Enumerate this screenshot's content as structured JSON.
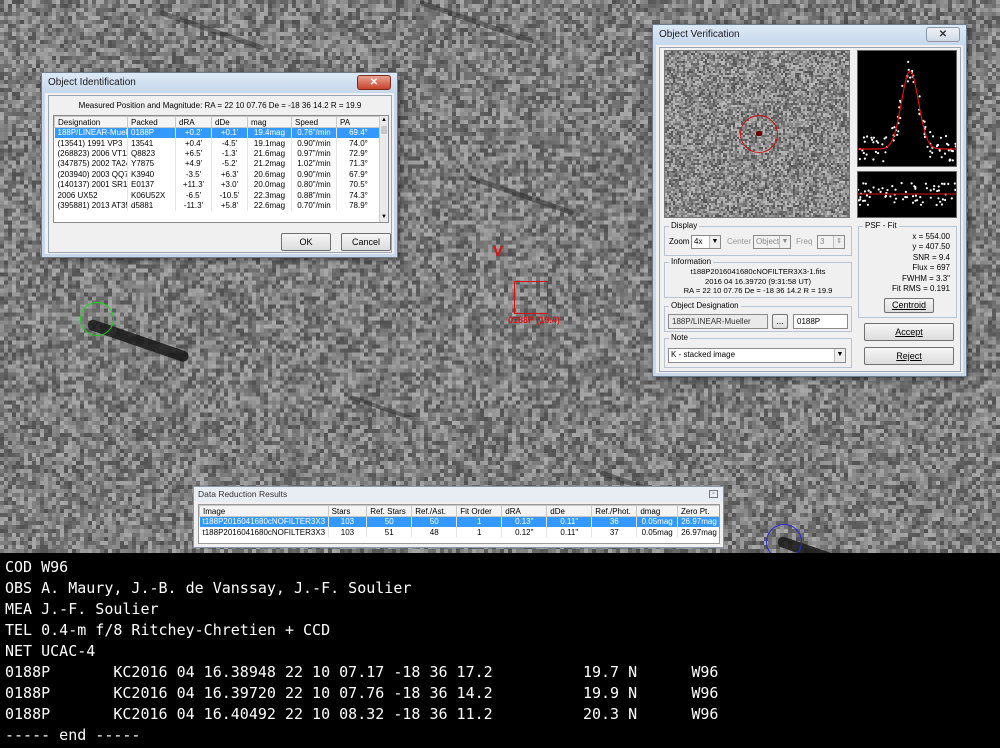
{
  "colors": {
    "selection": "#3399ff",
    "target_red": "#e01010",
    "circle_green": "#18d418",
    "circle_blue": "#2a2ae6"
  },
  "sky": {
    "target_label": "0188P (19.4)",
    "v_mark": "V"
  },
  "object_identification": {
    "title": "Object Identification",
    "close_icon": "close-icon",
    "measured_text": "Measured Position and Magnitude:  RA = 22 10 07.76   De = -18 36 14.2   R = 19.9",
    "columns": [
      "Designation",
      "Packed",
      "dRA",
      "dDe",
      "mag",
      "Speed",
      "PA"
    ],
    "rows": [
      [
        "188P/LINEAR-Muelle",
        "0188P",
        "+0.2'",
        "+0.1'",
        "19.4mag",
        "0.76\"/min",
        "69.4°"
      ],
      [
        "(13541) 1991 VP3",
        "13541",
        "+0.4'",
        "-4.5'",
        "19.1mag",
        "0.90\"/min",
        "74.0°"
      ],
      [
        "(268823) 2006 VT111",
        "Q8823",
        "+6.5'",
        "-1.3'",
        "21.6mag",
        "0.97\"/min",
        "72.9°"
      ],
      [
        "(347875) 2002 TA24",
        "Y7875",
        "+4.9'",
        "-5.2'",
        "21.2mag",
        "1.02\"/min",
        "71.3°"
      ],
      [
        "(203940) 2003 QQ77",
        "K3940",
        "-3.5'",
        "+6.3'",
        "20.6mag",
        "0.90\"/min",
        "67.9°"
      ],
      [
        "(140137) 2001 SR151",
        "E0137",
        "+11.3'",
        "+3.0'",
        "20.0mag",
        "0.80\"/min",
        "70.5°"
      ],
      [
        "2006 UX52",
        "K06U52X",
        "-6.5'",
        "-10.5'",
        "22.3mag",
        "0.88\"/min",
        "74.3°"
      ],
      [
        "(395881) 2013 AT35",
        "d5881",
        "-11.3'",
        "+5.8'",
        "22.6mag",
        "0.70\"/min",
        "78.9°"
      ]
    ],
    "ok_label": "OK",
    "cancel_label": "Cancel"
  },
  "object_verification": {
    "title": "Object Verification",
    "close_icon": "close-icon",
    "display_label": "Display",
    "zoom_label": "Zoom",
    "zoom_value": "4x",
    "center_label": "Center",
    "center_value": "Object",
    "freq_label": "Freq",
    "freq_value": "3",
    "information_label": "Information",
    "info_lines": [
      "t188P2016041680cNOFILTER3X3-1.fits",
      "2016 04 16.39720 (9:31:58 UT)",
      "RA = 22 10 07.76   De = -18 36 14.2   R = 19.9"
    ],
    "designation_label": "Object Designation",
    "designation_value": "188P/LINEAR-Mueller",
    "designation_browse": "...",
    "packed_value": "0188P",
    "note_label": "Note",
    "note_value": "K - stacked image",
    "psf_label": "PSF - Fit",
    "psf_lines": [
      "x = 554.00",
      "y = 407.50",
      "SNR = 9.4",
      "Flux = 697",
      "FWHM = 3.3\"",
      "Fit RMS = 0.191"
    ],
    "centroid_label": "Centroid",
    "accept_label": "Accept",
    "reject_label": "Reject"
  },
  "data_reduction": {
    "title": "Data Reduction Results",
    "columns": [
      "Image",
      "Stars",
      "Ref. Stars",
      "Ref./Ast.",
      "Fit Order",
      "dRA",
      "dDe",
      "Ref./Phot.",
      "dmag",
      "Zero Pt."
    ],
    "rows": [
      [
        "t188P2016041680cNOFILTER3X3",
        "103",
        "50",
        "50",
        "1",
        "0.13\"",
        "0.11\"",
        "36",
        "0.05mag",
        "26.97mag"
      ],
      [
        "t188P2016041680cNOFILTER3X3",
        "103",
        "51",
        "48",
        "1",
        "0.12\"",
        "0.11\"",
        "37",
        "0.05mag",
        "26.97mag"
      ]
    ]
  },
  "report": {
    "lines": [
      "COD W96",
      "OBS A. Maury, J.-B. de Vanssay, J.-F. Soulier",
      "MEA J.-F. Soulier",
      "TEL 0.4-m f/8 Ritchey-Chretien + CCD",
      "NET UCAC-4",
      "0188P       KC2016 04 16.38948 22 10 07.17 -18 36 17.2          19.7 N      W96",
      "0188P       KC2016 04 16.39720 22 10 07.76 -18 36 14.2          19.9 N      W96",
      "0188P       KC2016 04 16.40492 22 10 08.32 -18 36 11.2          20.3 N      W96",
      "----- end -----"
    ]
  }
}
